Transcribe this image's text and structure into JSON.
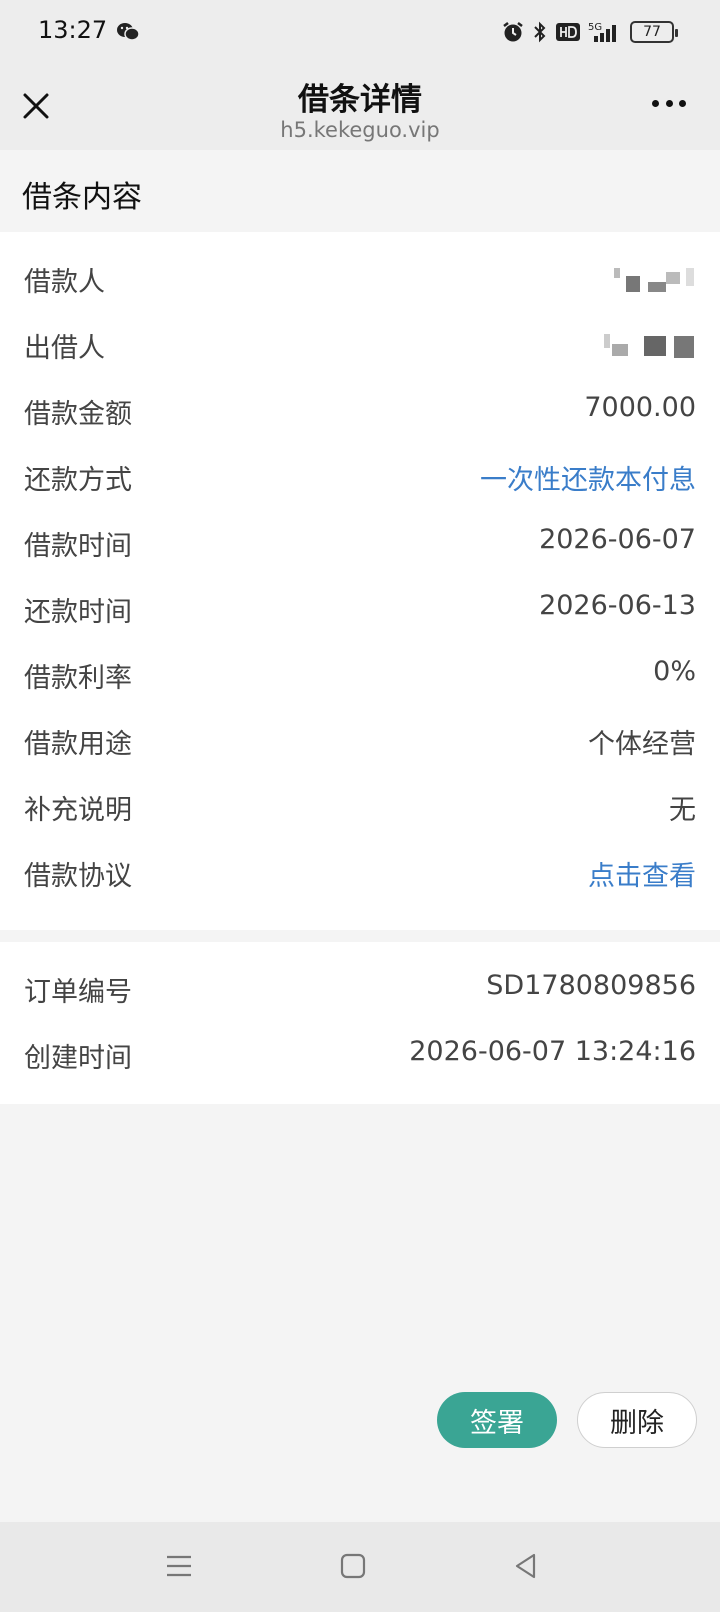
{
  "status_bar": {
    "time": "13:27",
    "icons": [
      "wechat-icon",
      "alarm-icon",
      "bluetooth-icon",
      "hd-icon",
      "signal-5g-icon"
    ],
    "battery_level": "77"
  },
  "nav": {
    "title": "借条详情",
    "subtitle": "h5.kekeguo.vip",
    "close_icon": "close-icon",
    "more_icon": "more-icon"
  },
  "section": {
    "title": "借条内容"
  },
  "details": [
    {
      "label": "借款人",
      "value": ""
    },
    {
      "label": "出借人",
      "value": ""
    },
    {
      "label": "借款金额",
      "value": "7000.00"
    },
    {
      "label": "还款方式",
      "value": "一次性还款本付息"
    },
    {
      "label": "借款时间",
      "value": "2026-06-07"
    },
    {
      "label": "还款时间",
      "value": "2026-06-13"
    },
    {
      "label": "借款利率",
      "value": "0%"
    },
    {
      "label": "借款用途",
      "value": "个体经营"
    },
    {
      "label": "补充说明",
      "value": "无"
    },
    {
      "label": "借款协议",
      "value": "点击查看"
    }
  ],
  "order": [
    {
      "label": "订单编号",
      "value": "SD1780809856"
    },
    {
      "label": "创建时间",
      "value": "2026-06-07 13:24:16"
    }
  ],
  "actions": {
    "sign": "签署",
    "delete": "删除"
  },
  "colors": {
    "accent": "#3aa594",
    "link": "#3a7dc9",
    "background": "#f4f4f4"
  },
  "system_nav": [
    "menu-icon",
    "home-icon",
    "back-icon"
  ]
}
